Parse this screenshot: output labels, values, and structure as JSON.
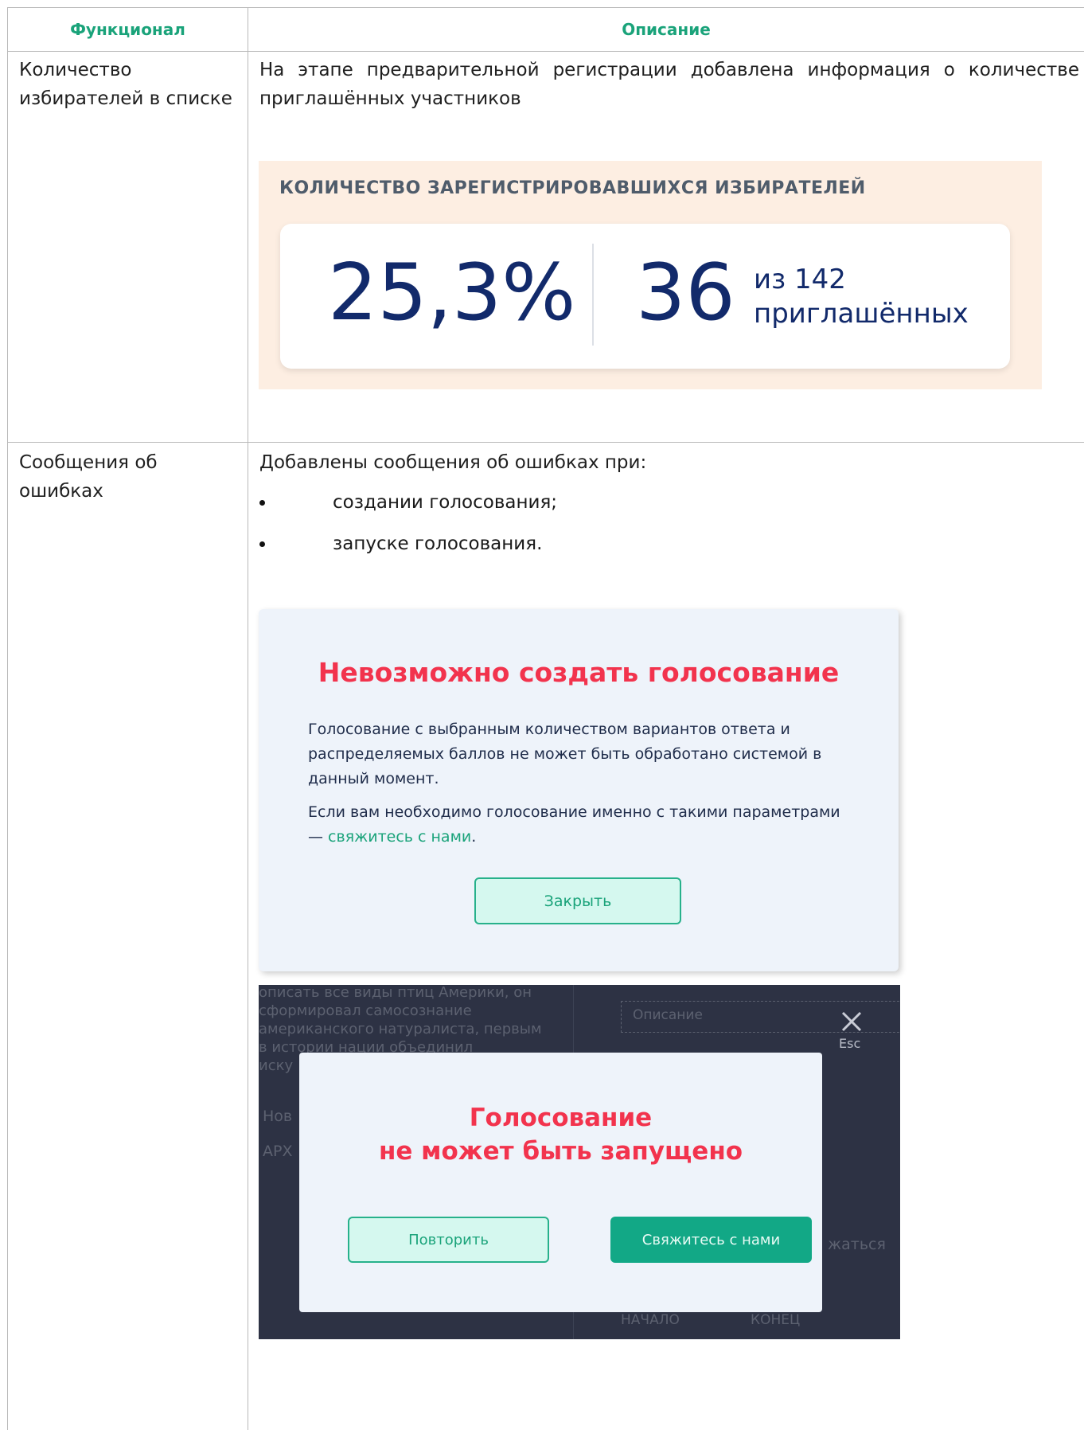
{
  "table": {
    "headers": {
      "func": "Функционал",
      "desc": "Описание"
    },
    "rows": [
      {
        "func": "Количество избирателей в списке",
        "desc": "На этапе предварительной регистрации добавлена информация о количестве приглашённых участников"
      },
      {
        "func": "Сообщения об ошибках",
        "desc_intro": "Добавлены сообщения об ошибках при:",
        "bullets": [
          "создании голосования;",
          "запуске голосования."
        ]
      }
    ]
  },
  "stats": {
    "title": "КОЛИЧЕСТВО ЗАРЕГИСТРИРОВАВШИХСЯ ИЗБИРАТЕЛЕЙ",
    "percent": "25,3%",
    "count": "36",
    "of_total": "из 142",
    "invited": "приглашённых"
  },
  "error_create": {
    "title": "Невозможно создать голосование",
    "p1": "Голосование с выбранным количеством вариантов ответа и распределяемых баллов не может быть обработано системой в данный момент.",
    "p2_prefix": "Если вам необходимо голосование именно с такими параметрами — ",
    "p2_link": "свяжитесь с нами",
    "p2_suffix": ".",
    "close_button": "Закрыть"
  },
  "error_launch": {
    "title_line1": "Голосование",
    "title_line2": "не может быть запущено",
    "retry_button": "Повторить",
    "contact_button": "Свяжитесь с нами",
    "esc_label": "Esc",
    "background": {
      "text_lines": [
        "описать все виды птиц Америки, он",
        "сформировал самосознание",
        "американского натуралиста, первым",
        "в истории нации объединил",
        "иску"
      ],
      "field_placeholder": "Описание",
      "item_1": "Нов",
      "item_2": "АРХ",
      "right_text": "жаться",
      "col_start": "НАЧАЛО",
      "col_end": "КОНЕЦ"
    }
  },
  "colors": {
    "header_green": "#1aa37a",
    "error_red": "#f2334d",
    "navy": "#122a6b",
    "peach_panel": "#fdeee2"
  }
}
